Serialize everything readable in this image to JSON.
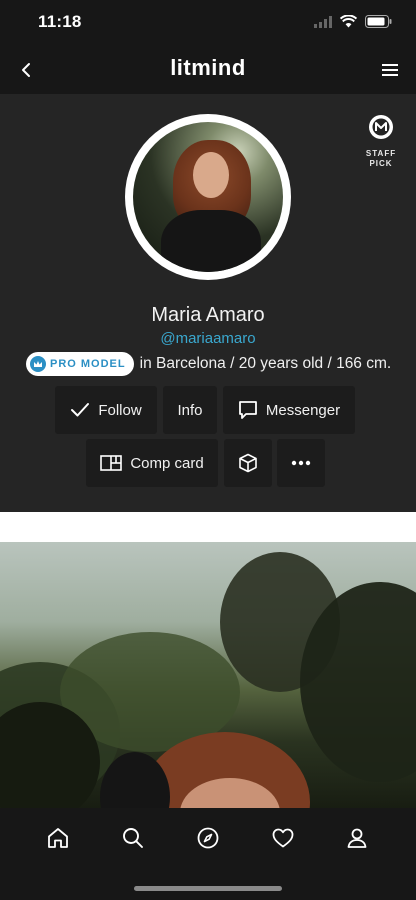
{
  "status": {
    "time": "11:18"
  },
  "nav": {
    "logo": "litmind"
  },
  "profile": {
    "staff_pick_label": "STAFF PICK",
    "name": "Maria Amaro",
    "handle": "@mariaamaro",
    "badge_label": "PRO MODEL",
    "meta": "in Barcelona / 20 years old / 166 cm."
  },
  "actions": {
    "follow": "Follow",
    "info": "Info",
    "messenger": "Messenger",
    "comp_card": "Comp card"
  },
  "tabs": [
    "home-icon",
    "search-icon",
    "compass-icon",
    "heart-icon",
    "user-icon"
  ],
  "colors": {
    "accent": "#3aa8cf",
    "badge": "#2b8fc4",
    "background": "#252525"
  }
}
